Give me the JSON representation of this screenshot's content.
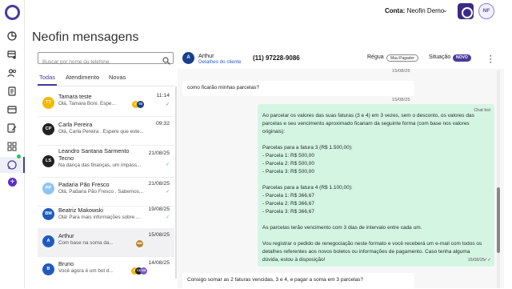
{
  "account": {
    "label": "Conta:",
    "name": "Neofin Demo",
    "initials": "NF"
  },
  "page_title": "Neofin mensagens",
  "search": {
    "placeholder": "Buscar por nome ou telefone"
  },
  "tabs": [
    {
      "label": "Todas"
    },
    {
      "label": "Atendimento"
    },
    {
      "label": "Novas"
    }
  ],
  "conversations": [
    {
      "initials": "TT",
      "name": "Tamara teste",
      "preview": "Olá, Tamara Boni. Espe...",
      "time": "11:14",
      "avatar_color": "#f5b800",
      "minis": [
        {
          "t": "E",
          "c": "#f5b800"
        },
        {
          "t": "TB",
          "c": "#173f8c"
        }
      ]
    },
    {
      "initials": "CP",
      "name": "Carla Pereira",
      "preview": "Olá, Carla Pereira . Espere que este...",
      "time": "09:32",
      "avatar_color": "#222222",
      "minis": []
    },
    {
      "initials": "LS",
      "name": "Leandro Santana Sarmento",
      "name2": "Tecno",
      "preview": "Na dança das finanças, um impass...",
      "time": "21/08/25",
      "avatar_color": "#222222",
      "minis": []
    },
    {
      "initials": "PP",
      "name": "Padaria Pão Fresco",
      "preview": "Olá, Padaria Pão Fresco . Sabemos...",
      "time": "21/08/25",
      "avatar_color": "#8ec5f0",
      "minis": []
    },
    {
      "initials": "BM",
      "name": "Beatriz Makowski",
      "preview": "Olá! Para mais informações sobre ...",
      "time": "19/08/25",
      "avatar_color": "#1e5bbf",
      "minis": []
    },
    {
      "initials": "A",
      "name": "Arthur",
      "preview": "Com base na soma da...",
      "time": "15/08/25",
      "avatar_color": "#1e5bbf",
      "minis": [
        {
          "t": "MM",
          "c": "#b8862f"
        }
      ]
    },
    {
      "initials": "B",
      "name": "Bruno",
      "preview": "Você agora é um bot d...",
      "time": "14/08/25",
      "avatar_color": "#1e5bbf",
      "minis": [
        {
          "t": "E",
          "c": "#f5b800"
        },
        {
          "t": "CF",
          "c": "#222222"
        },
        {
          "t": "CM",
          "c": "#7a5cc0"
        }
      ]
    }
  ],
  "chat_header": {
    "initial": "A",
    "name": "Arthur",
    "details_link": "Detalhes do cliente",
    "phone": "(11) 97228-9086",
    "rule_label": "Régua",
    "rule_value": "Mau Pagador",
    "situation_label": "Situação",
    "situation_value": "NOVO"
  },
  "messages": {
    "stamp1": "15/08/25",
    "incoming1": "como ficarão minhas parcelas?",
    "stamp2": "15/08/25",
    "bot_tag": "Chat bot",
    "bot_lines": [
      "Ao parcelar os valores das suas faturas (3 e 4) em 3 vezes, sem o desconto, os valores das",
      "parcelas e seu vencimento aproximado ficariam da seguinte forma (com base nos valores",
      "originais):",
      "",
      "Parcelas para a fatura 3 (R$ 1.500,00):",
      "- Parcela 1: R$ 500,00",
      "- Parcela 2: R$ 500,00",
      "- Parcela 3: R$ 500,00",
      "",
      "Parcelas para a fatura 4 (R$ 1.100,00):",
      "- Parcela 1: R$ 366,67",
      "- Parcela 2: R$ 366,67",
      "- Parcela 3: R$ 366,67",
      "",
      "As parcelas terão vencimento com 3 dias de intervalo entre cada um.",
      "",
      "Vou registrar o pedido de renegociação neste formato e você receberá um e-mail com todos os",
      "detalhes referentes aos novos boletos ou informações de pagamento. Caso tenha alguma",
      "dúvida, estou à disposição!"
    ],
    "bot_stamp": "15/08/25",
    "incoming2": "Consigo somar as 2 faturas vencidas, 3 e 4, e pagar a soma em 3 parcelas?"
  }
}
